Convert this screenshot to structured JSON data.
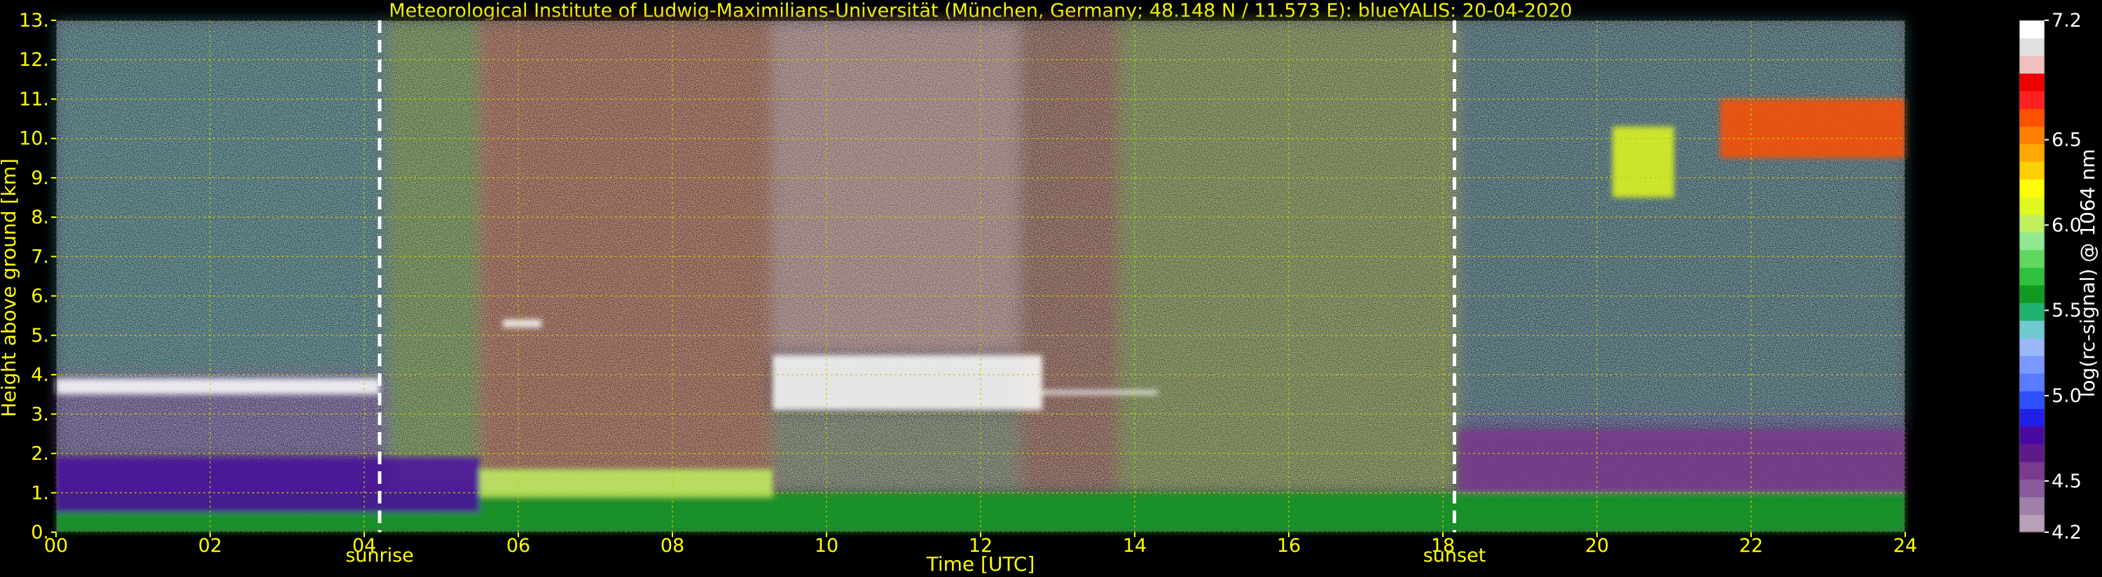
{
  "chart_data": {
    "type": "heatmap",
    "title": "Meteorological Institute of Ludwig-Maximilians-Universität (München, Germany; 48.148 N / 11.573 E):     blueYALIS: 20-04-2020",
    "xlabel": "Time [UTC]",
    "ylabel": "Height above ground [km]",
    "xlim": [
      0,
      24
    ],
    "ylim": [
      0,
      13
    ],
    "xticks": [
      "00",
      "02",
      "04",
      "06",
      "08",
      "10",
      "12",
      "14",
      "16",
      "18",
      "20",
      "22",
      "24"
    ],
    "yticks": [
      "0.",
      "1.",
      "2.",
      "3.",
      "4.",
      "5.",
      "6.",
      "7.",
      "8.",
      "9.",
      "10.",
      "11.",
      "12.",
      "13."
    ],
    "grid": true,
    "colorbar": {
      "label": "log(rc-signal) @ 1064 nm",
      "range": [
        4.2,
        7.2
      ],
      "ticks": [
        "4.2",
        "4.5",
        "5.0",
        "5.5",
        "6.0",
        "6.5",
        "7.2"
      ],
      "colors": [
        "#b8a0b8",
        "#a080a8",
        "#8a5a9a",
        "#7a3a8e",
        "#5e1a8a",
        "#4a0aa0",
        "#2020e8",
        "#3050ff",
        "#5a7aff",
        "#7a98ff",
        "#9ab8f8",
        "#70c8d0",
        "#20b070",
        "#109a20",
        "#30c040",
        "#60d860",
        "#90e890",
        "#c0f060",
        "#e0f820",
        "#ffff00",
        "#ffd000",
        "#ffa800",
        "#ff8000",
        "#ff5000",
        "#ff2020",
        "#ee0000",
        "#f0c0c0",
        "#e0e0e0",
        "#ffffff"
      ]
    },
    "annotations": [
      {
        "text": "sunrise",
        "x": 4.2
      },
      {
        "text": "sunset",
        "x": 18.15
      }
    ],
    "features": [
      {
        "kind": "boundary-layer-aerosol",
        "x": [
          0,
          24
        ],
        "y": [
          0,
          1.0
        ],
        "color": "#109a20"
      },
      {
        "kind": "residual-layer",
        "x": [
          0,
          5.5
        ],
        "y": [
          0.5,
          1.9
        ],
        "color": "#4a0aa0"
      },
      {
        "kind": "cloud",
        "x": [
          0,
          4.2
        ],
        "y": [
          3.5,
          3.9
        ],
        "color": "#ffffff"
      },
      {
        "kind": "cloud",
        "x": [
          5.8,
          6.3
        ],
        "y": [
          5.2,
          5.4
        ],
        "color": "#ffffff"
      },
      {
        "kind": "mixed-layer",
        "x": [
          5.5,
          9.3
        ],
        "y": [
          0.9,
          1.6
        ],
        "color": "#c0f060"
      },
      {
        "kind": "cloud",
        "x": [
          9.3,
          12.8
        ],
        "y": [
          3.1,
          4.5
        ],
        "color": "#ffffff"
      },
      {
        "kind": "thin-cloud-line",
        "x": [
          12.8,
          14.3
        ],
        "y": [
          3.5,
          3.6
        ],
        "color": "#ffffff"
      },
      {
        "kind": "evening-residual-layer",
        "x": [
          18.2,
          24
        ],
        "y": [
          1.0,
          2.6
        ],
        "color": "#7a3a8e"
      },
      {
        "kind": "cirrus",
        "x": [
          20.2,
          21.0
        ],
        "y": [
          8.5,
          10.3
        ],
        "color": "#e0f820"
      },
      {
        "kind": "cirrus",
        "x": [
          21.6,
          24
        ],
        "y": [
          9.5,
          11.0
        ],
        "color": "#ff5000"
      }
    ]
  }
}
